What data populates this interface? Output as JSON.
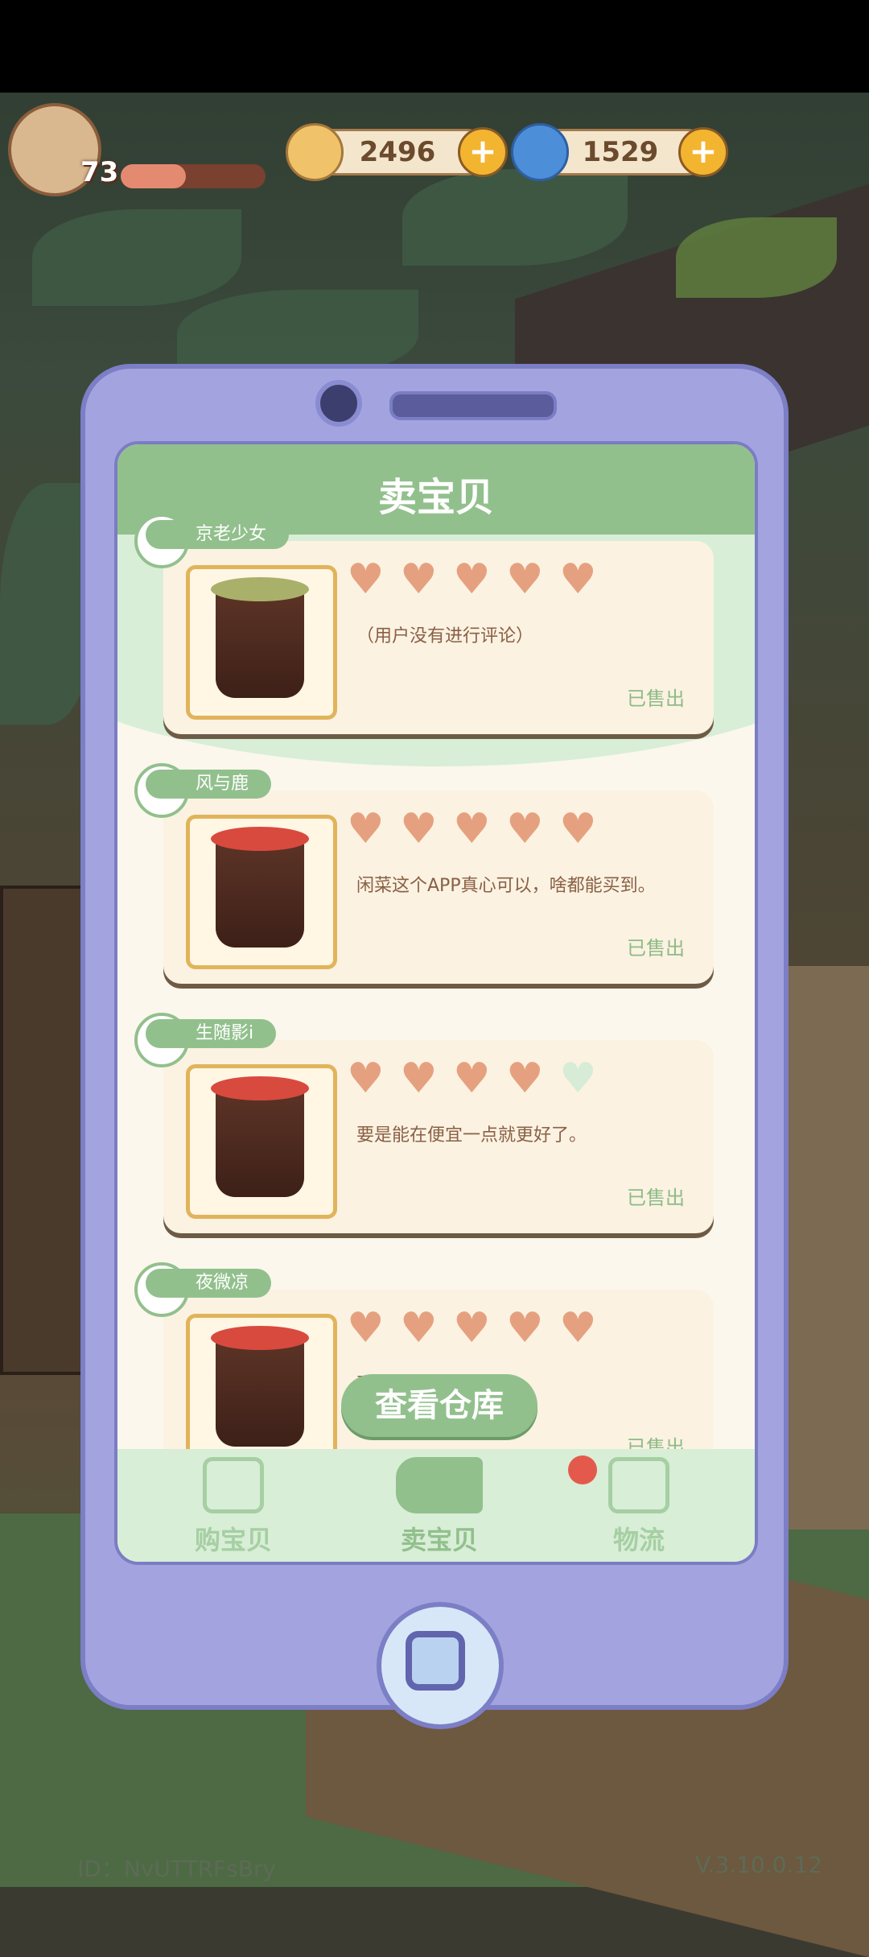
{
  "hud": {
    "level": "73",
    "xp_fraction": 0.45,
    "coins": "2496",
    "gems": "1529"
  },
  "screen": {
    "title": "卖宝贝",
    "warehouse_button": "查看仓库"
  },
  "reviews": [
    {
      "user": "京老少女",
      "rating": 5,
      "comment": "（用户没有进行评论）",
      "status": "已售出",
      "topping": "#a9b06a"
    },
    {
      "user": "风与鹿",
      "rating": 5,
      "comment": "闲菜这个APP真心可以，啥都能买到。",
      "status": "已售出",
      "topping": "#d84a3e"
    },
    {
      "user": "生随影i",
      "rating": 4,
      "comment": "要是能在便宜一点就更好了。",
      "status": "已售出",
      "topping": "#d84a3e"
    },
    {
      "user": "夜微凉",
      "rating": 5,
      "comment": "要起来的可以的新诶。",
      "status": "已售出",
      "topping": "#d84a3e"
    }
  ],
  "nav": {
    "buy": "购宝贝",
    "sell": "卖宝贝",
    "logistics": "物流"
  },
  "footer": {
    "id": "ID：NvUTTRFsBry",
    "version": "V.3.10.0.12"
  },
  "colors": {
    "accent_green": "#92c08d",
    "heart": "#e5a17f",
    "phone": "#a3a4df"
  }
}
